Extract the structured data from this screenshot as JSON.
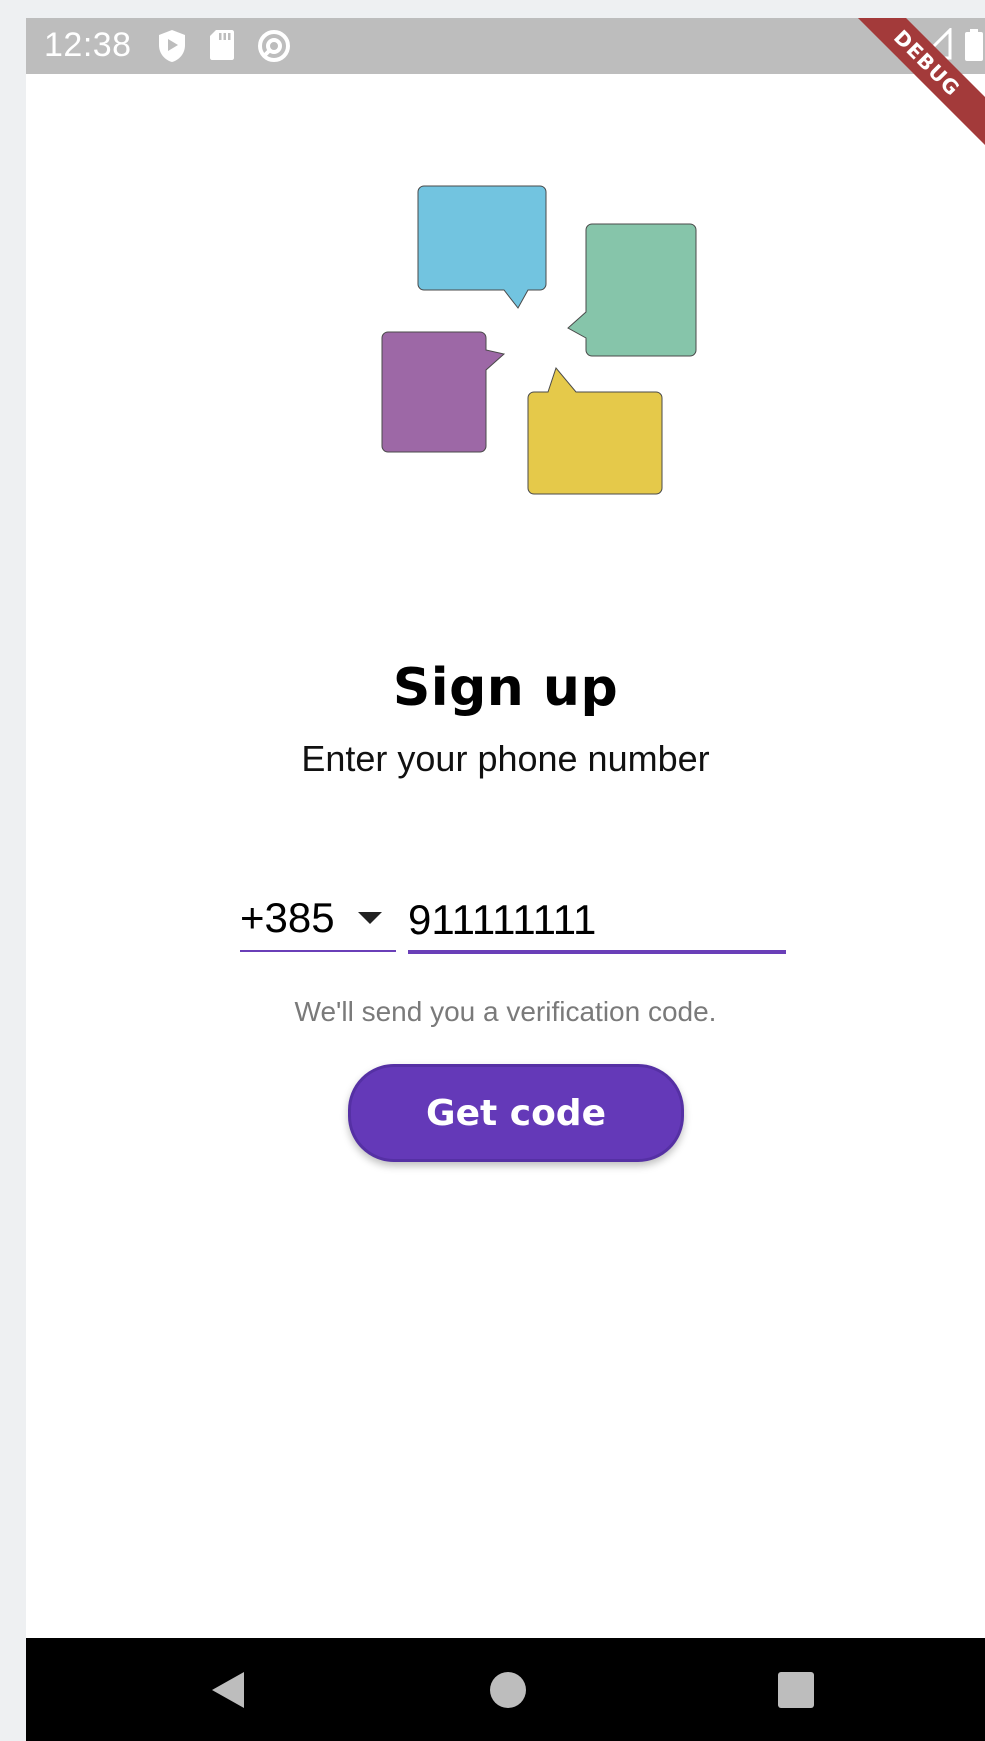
{
  "status_bar": {
    "time": "12:38",
    "icons": [
      "play-protect-icon",
      "sd-card-icon",
      "data-saver-icon",
      "wifi-icon",
      "signal-icon",
      "battery-icon"
    ],
    "debug_banner": "DEBUG"
  },
  "logo": {
    "bubbles": [
      {
        "name": "blue-bubble",
        "color": "#72c4e0"
      },
      {
        "name": "green-bubble",
        "color": "#86c5aa"
      },
      {
        "name": "purple-bubble",
        "color": "#9d68a6"
      },
      {
        "name": "yellow-bubble",
        "color": "#e5c94a"
      }
    ]
  },
  "screen": {
    "title": "Sign up",
    "subtitle": "Enter your phone number"
  },
  "form": {
    "country_code": "+385",
    "phone_value": "911111111",
    "helper_text": "We'll send you a verification code.",
    "submit_label": "Get code"
  },
  "colors": {
    "accent": "#6439b8",
    "underline": "#6a3fb8",
    "helper": "#7a7a7a"
  },
  "nav_bar": {
    "buttons": [
      "back-icon",
      "home-icon",
      "recents-icon"
    ]
  }
}
